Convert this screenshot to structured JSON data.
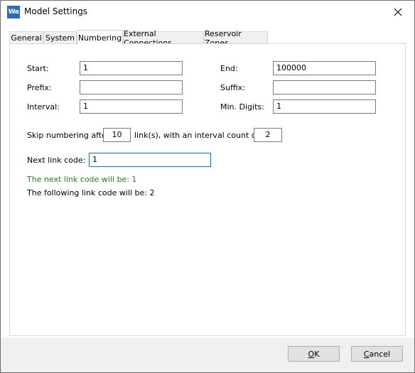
{
  "window": {
    "title": "Model Settings",
    "app_icon_text": "Wa"
  },
  "tabs": [
    {
      "label": "General",
      "active": false
    },
    {
      "label": "System",
      "active": false
    },
    {
      "label": "Numbering",
      "active": true
    },
    {
      "label": "External Connections",
      "active": false
    },
    {
      "label": "Reservoir Zones",
      "active": false
    }
  ],
  "form": {
    "start_label": "Start:",
    "start_value": "1",
    "end_label": "End:",
    "end_value": "100000",
    "prefix_label": "Prefix:",
    "prefix_value": "",
    "suffix_label": "Suffix:",
    "suffix_value": "",
    "interval_label": "Interval:",
    "interval_value": "1",
    "min_digits_label": "Min. Digits:",
    "min_digits_value": "1",
    "skip_prefix_text": "Skip numbering after",
    "skip_value": "10",
    "skip_middle_text": "link(s), with an interval count of",
    "interval_count_value": "2",
    "next_link_label": "Next link code:",
    "next_link_value": "1",
    "next_code_message": "The next link code will be: 1",
    "following_code_message": "The following link code will be: 2"
  },
  "buttons": {
    "ok_label": "OK",
    "ok_mnemonic": "O",
    "ok_rest": "K",
    "cancel_label": "Cancel",
    "cancel_mnemonic": "C",
    "cancel_rest": "ancel"
  },
  "colors": {
    "accent": "#0078d7",
    "success_text": "#1a8a1a",
    "app_icon_bg": "#2b6cb5"
  }
}
